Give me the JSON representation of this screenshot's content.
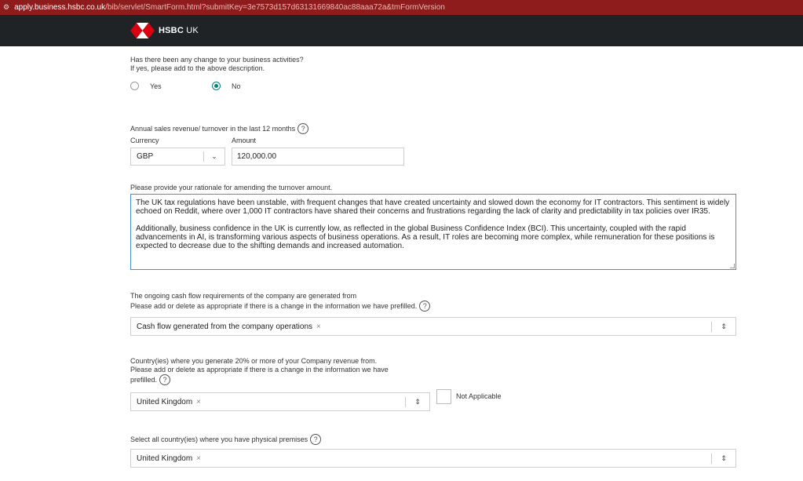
{
  "browser": {
    "url_host": "apply.business.hsbc.co.uk",
    "url_path": "/bib/servlet/SmartForm.html?submitKey=3e7573d157d63131669840ac88aaa72a&tmFormVersion"
  },
  "header": {
    "brand": "HSBC",
    "brand_suffix": "UK"
  },
  "business_change": {
    "question_line1": "Has there been any change to your business activities?",
    "question_line2": "If yes, please add to the above description.",
    "options": [
      {
        "label": "Yes",
        "checked": false
      },
      {
        "label": "No",
        "checked": true
      }
    ]
  },
  "turnover": {
    "label": "Annual sales revenue/ turnover in the last 12 months",
    "currency_label": "Currency",
    "currency_value": "GBP",
    "amount_label": "Amount",
    "amount_value": "120,000.00"
  },
  "rationale": {
    "label": "Please provide your rationale for amending the turnover amount.",
    "paragraph1": "The UK tax regulations have been unstable, with frequent changes that have created uncertainty and slowed down the economy for IT contractors. This sentiment is widely echoed on Reddit, where over 1,000 IT contractors have shared their concerns and frustrations regarding the lack of clarity and predictability in tax policies over IR35.",
    "paragraph2": "Additionally, business confidence in the UK is currently low, as reflected in the global Business Confidence Index (BCI). This uncertainty, coupled with the rapid advancements in AI, is transforming various aspects of business operations. As a result, IT roles are becoming more complex, while remuneration for these positions is expected to decrease due to the shifting demands and increased automation."
  },
  "cashflow": {
    "label_line1": "The ongoing cash flow requirements of the company are generated from",
    "label_line2": "Please add or delete as appropriate if there is a change in the information we have prefilled.",
    "chip": "Cash flow generated from the company operations"
  },
  "revenue_countries": {
    "label_line1": "Country(ies) where you generate 20% or more of your Company revenue from.",
    "label_line2": "Please add or delete as appropriate if there is a change in the information we have",
    "label_line3": "prefilled.",
    "chip": "United Kingdom",
    "not_applicable_label": "Not Applicable"
  },
  "premises": {
    "label": "Select all country(ies) where you have physical premises",
    "chip": "United Kingdom"
  },
  "icons": {
    "help": "?",
    "remove": "×",
    "chevron_down": "⌄",
    "updown": "⇕"
  },
  "colors": {
    "url_bar": "#8e1c1c",
    "header": "#1f2326",
    "brand_red": "#db0011",
    "accent": "#00847f",
    "focus_border": "#4a90c9"
  }
}
